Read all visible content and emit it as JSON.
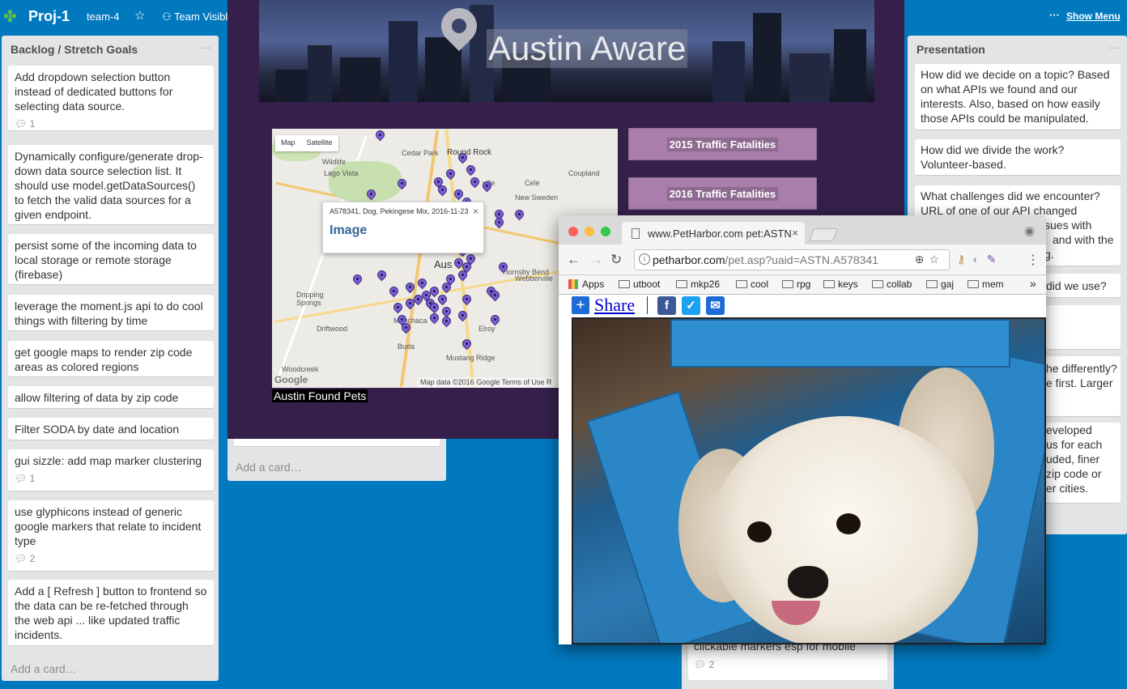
{
  "topbar": {
    "board_name": "Proj-1",
    "team": "team-4",
    "visibility": "Team Visibl",
    "show_menu": "Show Menu"
  },
  "backlog": {
    "title": "Backlog / Stretch Goals",
    "cards": [
      {
        "text": "Add dropdown selection button instead of dedicated buttons for selecting data source.",
        "comments": "1"
      },
      {
        "text": "Dynamically configure/generate drop-down data source selection list. It should use model.getDataSources() to fetch the valid data sources for a given endpoint.",
        "comments": ""
      },
      {
        "text": "persist some of the incoming data to local storage or remote storage (firebase)",
        "comments": ""
      },
      {
        "text": "leverage the moment.js api to do cool things with filtering by time",
        "comments": ""
      },
      {
        "text": "get google maps to render zip code areas as colored regions",
        "comments": ""
      },
      {
        "text": "allow filtering of data by zip code",
        "comments": ""
      },
      {
        "text": "Filter SODA by date and location",
        "comments": ""
      },
      {
        "text": "gui sizzle: add map marker clustering",
        "comments": "1"
      },
      {
        "text": "use glyphicons instead of generic google markers that relate to incident type",
        "comments": "2"
      },
      {
        "text": "Add a [ Refresh ] button to frontend so the data can be re-fetched through the web api ... like updated traffic incidents.",
        "comments": ""
      }
    ],
    "add_card": "Add a card…"
  },
  "middle_list": {
    "add_card": "Add a card…"
  },
  "presentation": {
    "title": "Presentation",
    "cards": [
      "How did we decide on a topic? Based on what APIs we found and our interests. Also, based on how easily those APIs could be manipulated.",
      "How did we divide the work? Volunteer-based.",
      "What challenges did we encounter? URL of one of our API changed",
      "sues with",
      "and with the",
      "g.",
      "did we use?",
      "he differently?",
      "e first. Larger",
      "eveloped",
      "us for each",
      "uded, finer",
      "zip code or",
      "er cities."
    ]
  },
  "bottom_card": {
    "text": "clickable markers esp for mobile",
    "comments": "2"
  },
  "austin_app": {
    "title": "Austin Aware",
    "map": {
      "tab_map": "Map",
      "tab_satellite": "Satellite",
      "popup_title": "A578341, Dog, Pekingese Mix, 2016-11-23",
      "popup_link": "Image",
      "popup_close": "×",
      "footer": "Map data ©2016 Google    Terms of Use   R",
      "google_logo": "Google",
      "places": [
        "Cedar Park",
        "Round Rock",
        "Lago Vista",
        "Coupland",
        "Cele",
        "New Sweden",
        "Hornsby Bend",
        "Webberville",
        "Dripping Springs",
        "Driftwood",
        "Manchaca",
        "Elroy",
        "Buda",
        "Mustang Ridge",
        "Woodcreek",
        "Aus",
        "Wildlife",
        "Map",
        "ville"
      ]
    },
    "caption": "Austin Found Pets",
    "buttons": [
      "2015 Traffic Fatalities",
      "2016 Traffic Fatalities"
    ]
  },
  "browser": {
    "tab_title": "www.PetHarbor.com pet:ASTN",
    "tab_close": "×",
    "url_host": "petharbor.com",
    "url_path": "/pet.asp?uaid=ASTN.A578341",
    "bookmarks": [
      "Apps",
      "utboot",
      "mkp26",
      "cool",
      "rpg",
      "keys",
      "collab",
      "gaj",
      "mem"
    ],
    "bookmarks_more": "»",
    "share_label": "Share",
    "colors": {
      "close": "#fc605c",
      "minimize": "#fdbc40",
      "zoom": "#34c84a",
      "share": "#1e6ad6",
      "facebook": "#3b5998",
      "twitter": "#1da1f2",
      "email": "#1e6ad6"
    }
  }
}
